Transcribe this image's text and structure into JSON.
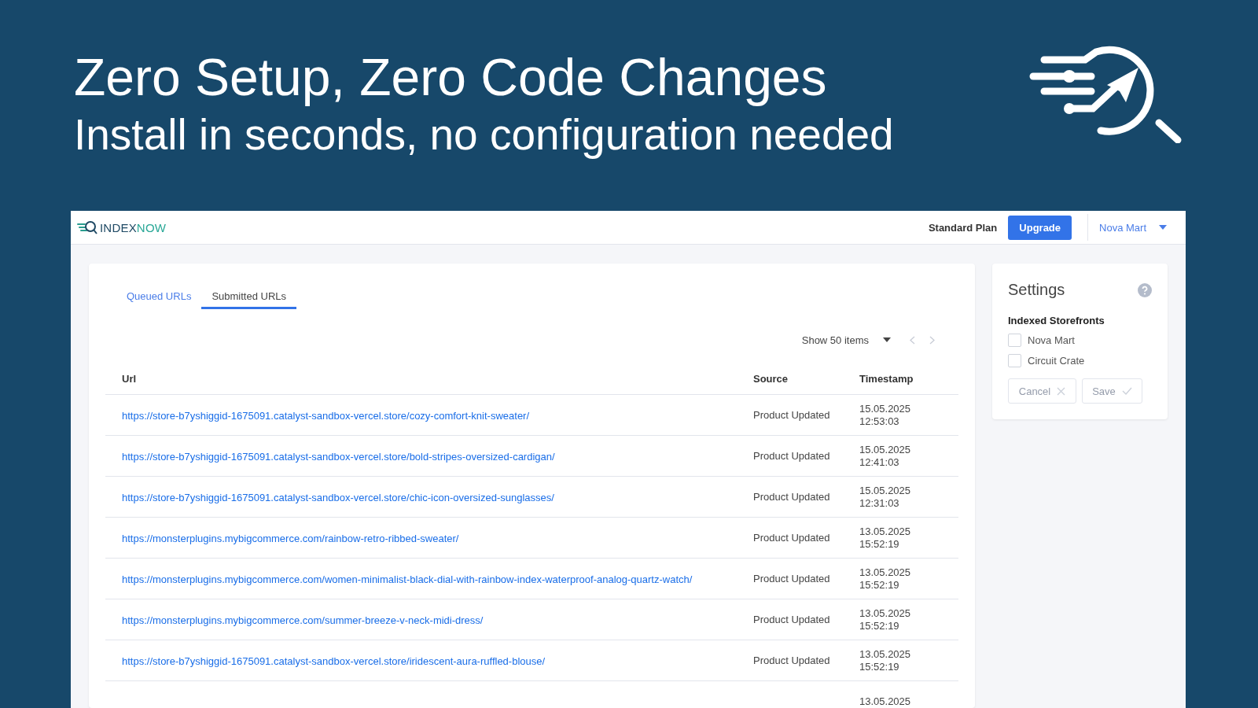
{
  "banner": {
    "title": "Zero Setup, Zero Code Changes",
    "subtitle": "Install in seconds, no configuration needed"
  },
  "app": {
    "brand": {
      "part_1": "INDEX",
      "part_2": "NOW"
    },
    "plan": "Standard Plan",
    "upgrade": "Upgrade",
    "store_menu": "Nova Mart",
    "tabs": [
      {
        "label": "Queued URLs",
        "selected": false
      },
      {
        "label": "Submitted URLs",
        "selected": true
      }
    ],
    "page_size": "Show 50 items",
    "table": {
      "columns": [
        "Url",
        "Source",
        "Timestamp"
      ],
      "rows": [
        {
          "url": "https://store-b7yshiggid-1675091.catalyst-sandbox-vercel.store/cozy-comfort-knit-sweater/",
          "source": "Product Updated",
          "date": "15.05.2025",
          "time": "12:53:03"
        },
        {
          "url": "https://store-b7yshiggid-1675091.catalyst-sandbox-vercel.store/bold-stripes-oversized-cardigan/",
          "source": "Product Updated",
          "date": "15.05.2025",
          "time": "12:41:03"
        },
        {
          "url": "https://store-b7yshiggid-1675091.catalyst-sandbox-vercel.store/chic-icon-oversized-sunglasses/",
          "source": "Product Updated",
          "date": "15.05.2025",
          "time": "12:31:03"
        },
        {
          "url": "https://monsterplugins.mybigcommerce.com/rainbow-retro-ribbed-sweater/",
          "source": "Product Updated",
          "date": "13.05.2025",
          "time": "15:52:19"
        },
        {
          "url": "https://monsterplugins.mybigcommerce.com/women-minimalist-black-dial-with-rainbow-index-waterproof-analog-quartz-watch/",
          "source": "Product Updated",
          "date": "13.05.2025",
          "time": "15:52:19"
        },
        {
          "url": "https://monsterplugins.mybigcommerce.com/summer-breeze-v-neck-midi-dress/",
          "source": "Product Updated",
          "date": "13.05.2025",
          "time": "15:52:19"
        },
        {
          "url": "https://store-b7yshiggid-1675091.catalyst-sandbox-vercel.store/iridescent-aura-ruffled-blouse/",
          "source": "Product Updated",
          "date": "13.05.2025",
          "time": "15:52:19"
        },
        {
          "date": "13.05.2025"
        }
      ]
    }
  },
  "settings": {
    "title": "Settings",
    "section": "Indexed Storefronts",
    "storefronts": [
      {
        "label": "Nova Mart",
        "checked": false
      },
      {
        "label": "Circuit Crate",
        "checked": false
      }
    ],
    "buttons": [
      {
        "label": "Cancel",
        "kind": "cancel",
        "disabled": true
      },
      {
        "label": "Save",
        "kind": "save",
        "disabled": true
      }
    ]
  }
}
